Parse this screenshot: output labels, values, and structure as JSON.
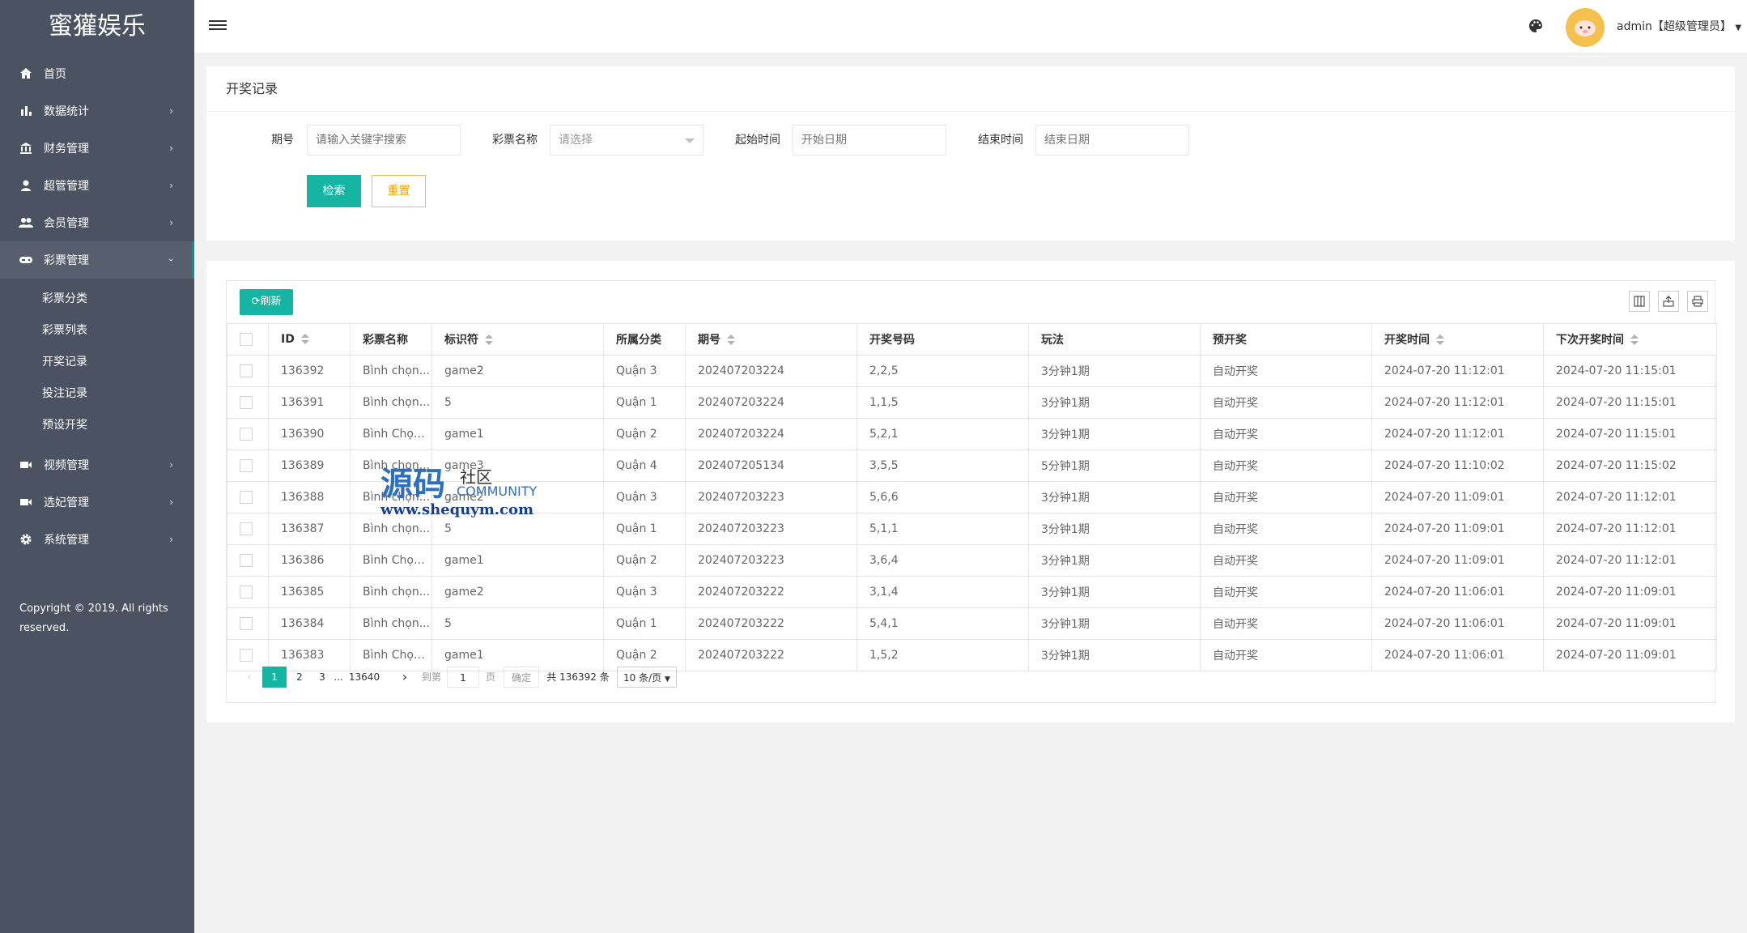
{
  "app": {
    "logo": "蜜獾娱乐"
  },
  "sidebar": {
    "items": [
      {
        "label": "首页",
        "icon": "home-icon"
      },
      {
        "label": "数据统计",
        "icon": "bar-chart-icon",
        "arrow": "›"
      },
      {
        "label": "财务管理",
        "icon": "bank-icon",
        "arrow": "›"
      },
      {
        "label": "超管管理",
        "icon": "user-icon",
        "arrow": "›"
      },
      {
        "label": "会员管理",
        "icon": "users-icon",
        "arrow": "›"
      },
      {
        "label": "彩票管理",
        "icon": "gamepad-icon",
        "arrow": "›"
      },
      {
        "label": "视频管理",
        "icon": "video-icon",
        "arrow": "›"
      },
      {
        "label": "选妃管理",
        "icon": "video-icon",
        "arrow": "›"
      },
      {
        "label": "系统管理",
        "icon": "gear-icon",
        "arrow": "›"
      }
    ],
    "sub_items": [
      "彩票分类",
      "彩票列表",
      "开奖记录",
      "投注记录",
      "预设开奖"
    ],
    "copyright": "Copyright © 2019. All rights reserved."
  },
  "header": {
    "user": "admin【超级管理员】"
  },
  "search": {
    "title": "开奖记录",
    "period_label": "期号",
    "period_placeholder": "请输入关键字搜索",
    "lottery_label": "彩票名称",
    "lottery_placeholder": "请选择",
    "start_label": "起始时间",
    "start_placeholder": "开始日期",
    "end_label": "结束时间",
    "end_placeholder": "结束日期",
    "search_btn": "检索",
    "reset_btn": "重置"
  },
  "table": {
    "refresh": "刷新",
    "columns": [
      "ID",
      "彩票名称",
      "标识符",
      "所属分类",
      "期号",
      "开奖号码",
      "玩法",
      "预开奖",
      "开奖时间",
      "下次开奖时间"
    ],
    "rows": [
      [
        "136392",
        "Bình chọn...",
        "game2",
        "Quận 3",
        "202407203224",
        "2,2,5",
        "3分钟1期",
        "自动开奖",
        "2024-07-20 11:12:01",
        "2024-07-20 11:15:01"
      ],
      [
        "136391",
        "Bình chọn...",
        "5",
        "Quận 1",
        "202407203224",
        "1,1,5",
        "3分钟1期",
        "自动开奖",
        "2024-07-20 11:12:01",
        "2024-07-20 11:15:01"
      ],
      [
        "136390",
        "Bình Chọn...",
        "game1",
        "Quận 2",
        "202407203224",
        "5,2,1",
        "3分钟1期",
        "自动开奖",
        "2024-07-20 11:12:01",
        "2024-07-20 11:15:01"
      ],
      [
        "136389",
        "Bình chọn...",
        "game3",
        "Quận 4",
        "202407205134",
        "3,5,5",
        "5分钟1期",
        "自动开奖",
        "2024-07-20 11:10:02",
        "2024-07-20 11:15:02"
      ],
      [
        "136388",
        "Bình chọn...",
        "game2",
        "Quận 3",
        "202407203223",
        "5,6,6",
        "3分钟1期",
        "自动开奖",
        "2024-07-20 11:09:01",
        "2024-07-20 11:12:01"
      ],
      [
        "136387",
        "Bình chọn...",
        "5",
        "Quận 1",
        "202407203223",
        "5,1,1",
        "3分钟1期",
        "自动开奖",
        "2024-07-20 11:09:01",
        "2024-07-20 11:12:01"
      ],
      [
        "136386",
        "Bình Chọn...",
        "game1",
        "Quận 2",
        "202407203223",
        "3,6,4",
        "3分钟1期",
        "自动开奖",
        "2024-07-20 11:09:01",
        "2024-07-20 11:12:01"
      ],
      [
        "136385",
        "Bình chọn...",
        "game2",
        "Quận 3",
        "202407203222",
        "3,1,4",
        "3分钟1期",
        "自动开奖",
        "2024-07-20 11:06:01",
        "2024-07-20 11:09:01"
      ],
      [
        "136384",
        "Bình chọn...",
        "5",
        "Quận 1",
        "202407203222",
        "5,4,1",
        "3分钟1期",
        "自动开奖",
        "2024-07-20 11:06:01",
        "2024-07-20 11:09:01"
      ],
      [
        "136383",
        "Bình Chọn...",
        "game1",
        "Quận 2",
        "202407203222",
        "1,5,2",
        "3分钟1期",
        "自动开奖",
        "2024-07-20 11:06:01",
        "2024-07-20 11:09:01"
      ]
    ]
  },
  "pager": {
    "p1": "1",
    "p2": "2",
    "p3": "3",
    "ellipsis": "...",
    "last": "13640",
    "goto": "到第",
    "goto_value": "1",
    "page_unit": "页",
    "confirm": "确定",
    "total": "共 136392 条",
    "per_page": "10 条/页"
  },
  "watermark": {
    "big": "源码",
    "small": "社区",
    "community": "COMMUNITY",
    "url": "www.shequym.com"
  }
}
